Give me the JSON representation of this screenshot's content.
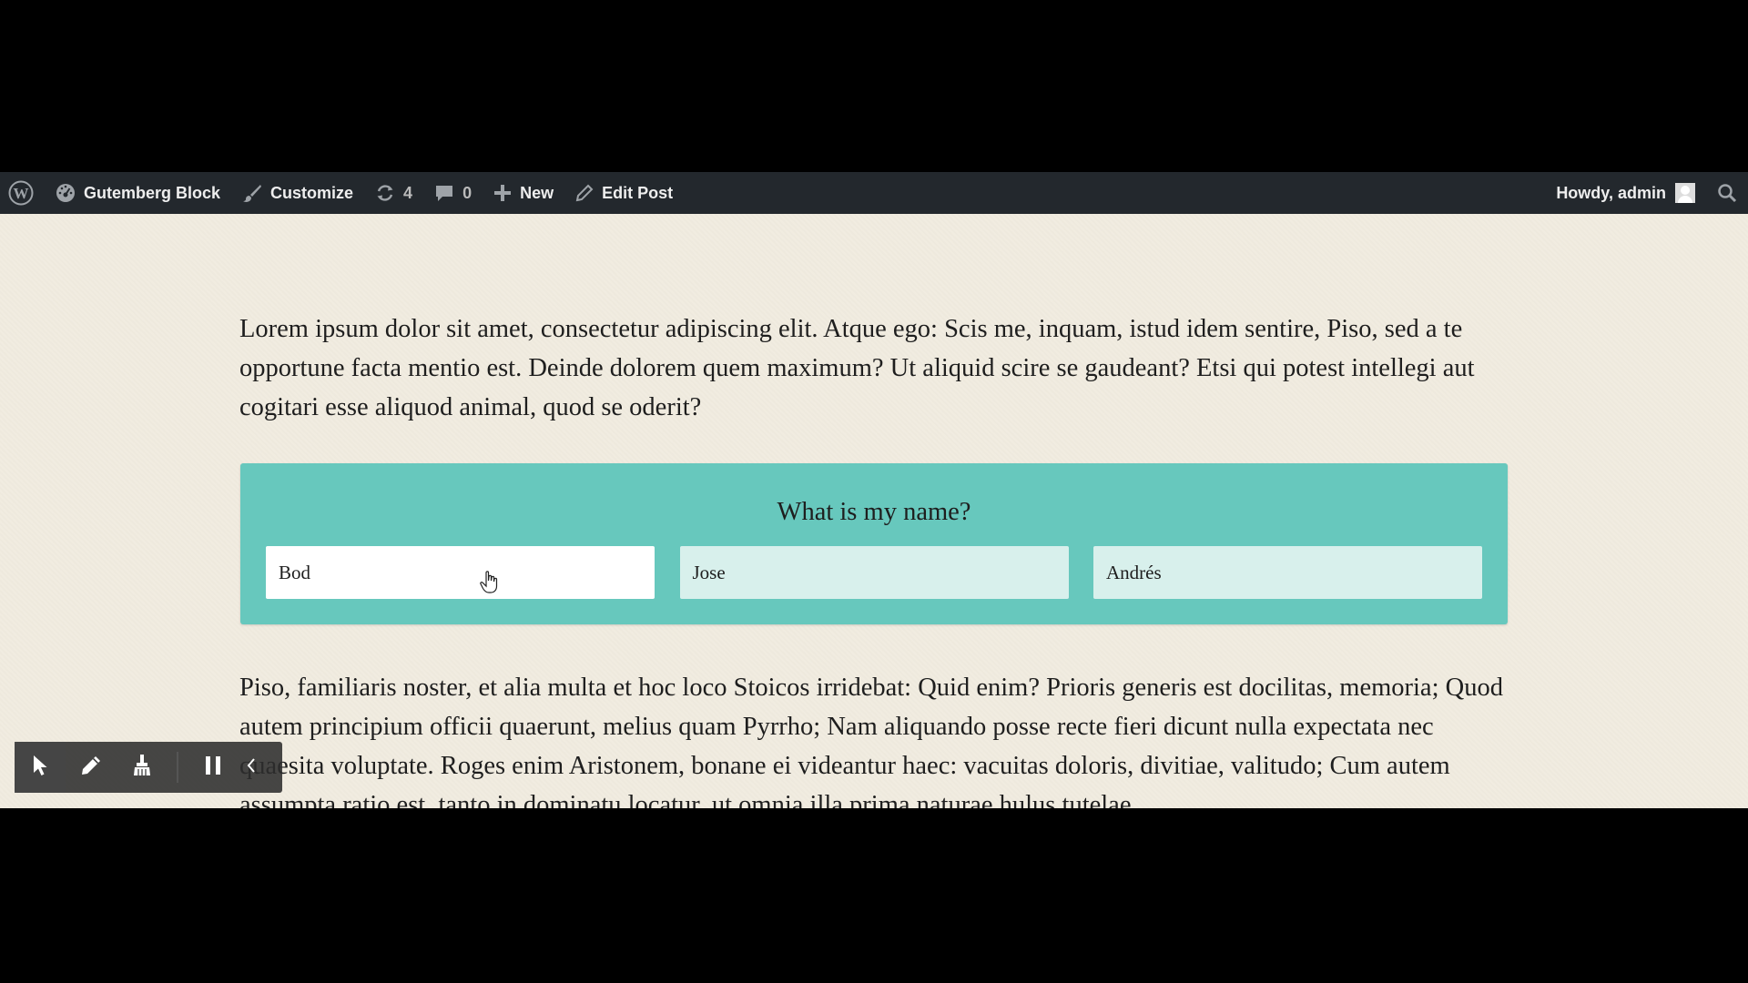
{
  "adminbar": {
    "wp_logo": "wordpress-logo-icon",
    "site_name": "Gutemberg Block",
    "customize": "Customize",
    "updates_count": "4",
    "comments_count": "0",
    "new_label": "New",
    "edit_post": "Edit Post",
    "greeting": "Howdy, admin"
  },
  "content": {
    "paragraph_1": "Lorem ipsum dolor sit amet, consectetur adipiscing elit. Atque ego: Scis me, inquam, istud idem sentire, Piso, sed a te opportune facta mentio est. Deinde dolorem quem maximum? Ut aliquid scire se gaudeant? Etsi qui potest intellegi aut cogitari esse aliquod animal, quod se oderit?",
    "quiz": {
      "question": "What is my name?",
      "answers": [
        "Bod",
        "Jose",
        "Andrés"
      ]
    },
    "paragraph_2": "Piso, familiaris noster, et alia multa et hoc loco Stoicos irridebat: Quid enim? Prioris generis est docilitas, memoria; Quod autem principium officii quaerunt, melius quam Pyrrho; Nam aliquando posse recte fieri dicunt nulla expectata nec quaesita voluptate. Roges enim Aristonem, bonane ei videantur haec: vacuitas doloris, divitiae, valitudo; Cum autem assumpta ratio est, tanto in dominatu locatur, ut omnia illa prima naturae hulus tutelae"
  },
  "colors": {
    "adminbar_bg": "#23282d",
    "page_bg": "#f1ece0",
    "quiz_bg": "#67c8bd",
    "answer_bg": "#d8f0ec",
    "answer_hover_bg": "#ffffff"
  },
  "toolbar": {
    "icons": [
      "pointer-icon",
      "pencil-icon",
      "broom-icon",
      "pause-icon",
      "chevron-left-icon"
    ]
  }
}
